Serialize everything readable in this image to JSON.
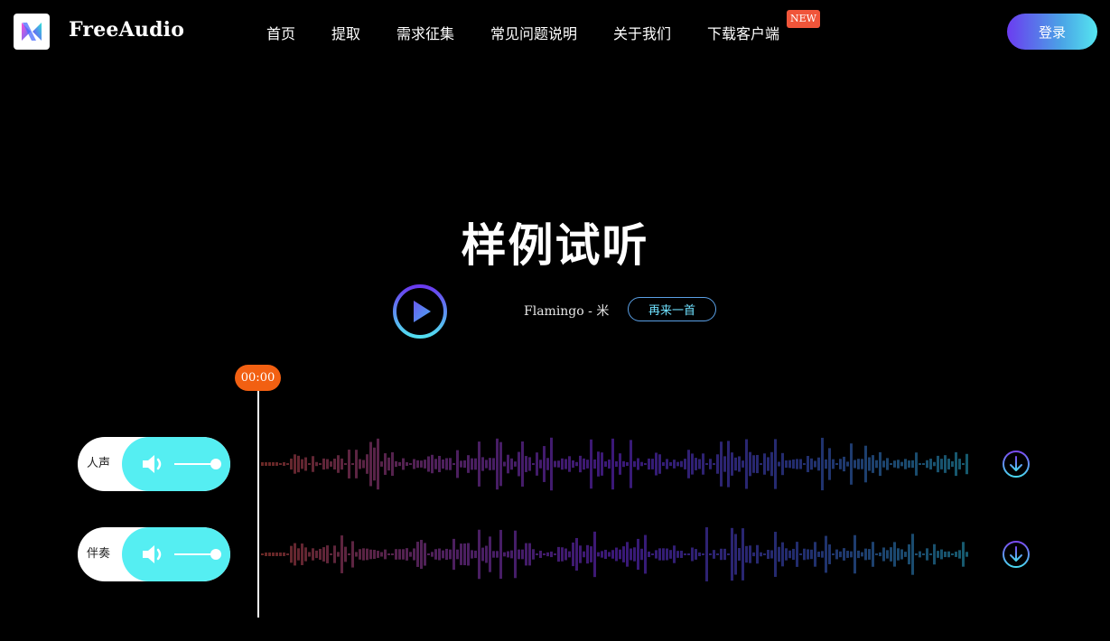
{
  "brand": {
    "name": "FreeAudio"
  },
  "nav": {
    "items": [
      "首页",
      "提取",
      "需求征集",
      "常见问题说明",
      "关于我们",
      "下载客户端"
    ],
    "new_badge": "NEW"
  },
  "login": {
    "label": "登录"
  },
  "hero": {
    "title": "样例试听"
  },
  "player": {
    "track": "Flamingo - 米津玄师",
    "again_label": "再来一首",
    "time": "00:00"
  },
  "tracks": [
    {
      "label": "人声"
    },
    {
      "label": "伴奏"
    }
  ],
  "colors": {
    "accent": "#55eef2",
    "time_badge": "#f26012",
    "new_badge": "#f0553a",
    "gradient_start": "#6b3cf0",
    "gradient_end": "#55e6f0"
  },
  "icons": {
    "logo": "freeaudio-logo-icon",
    "play": "play-icon",
    "volume": "speaker-icon",
    "download": "download-icon"
  }
}
